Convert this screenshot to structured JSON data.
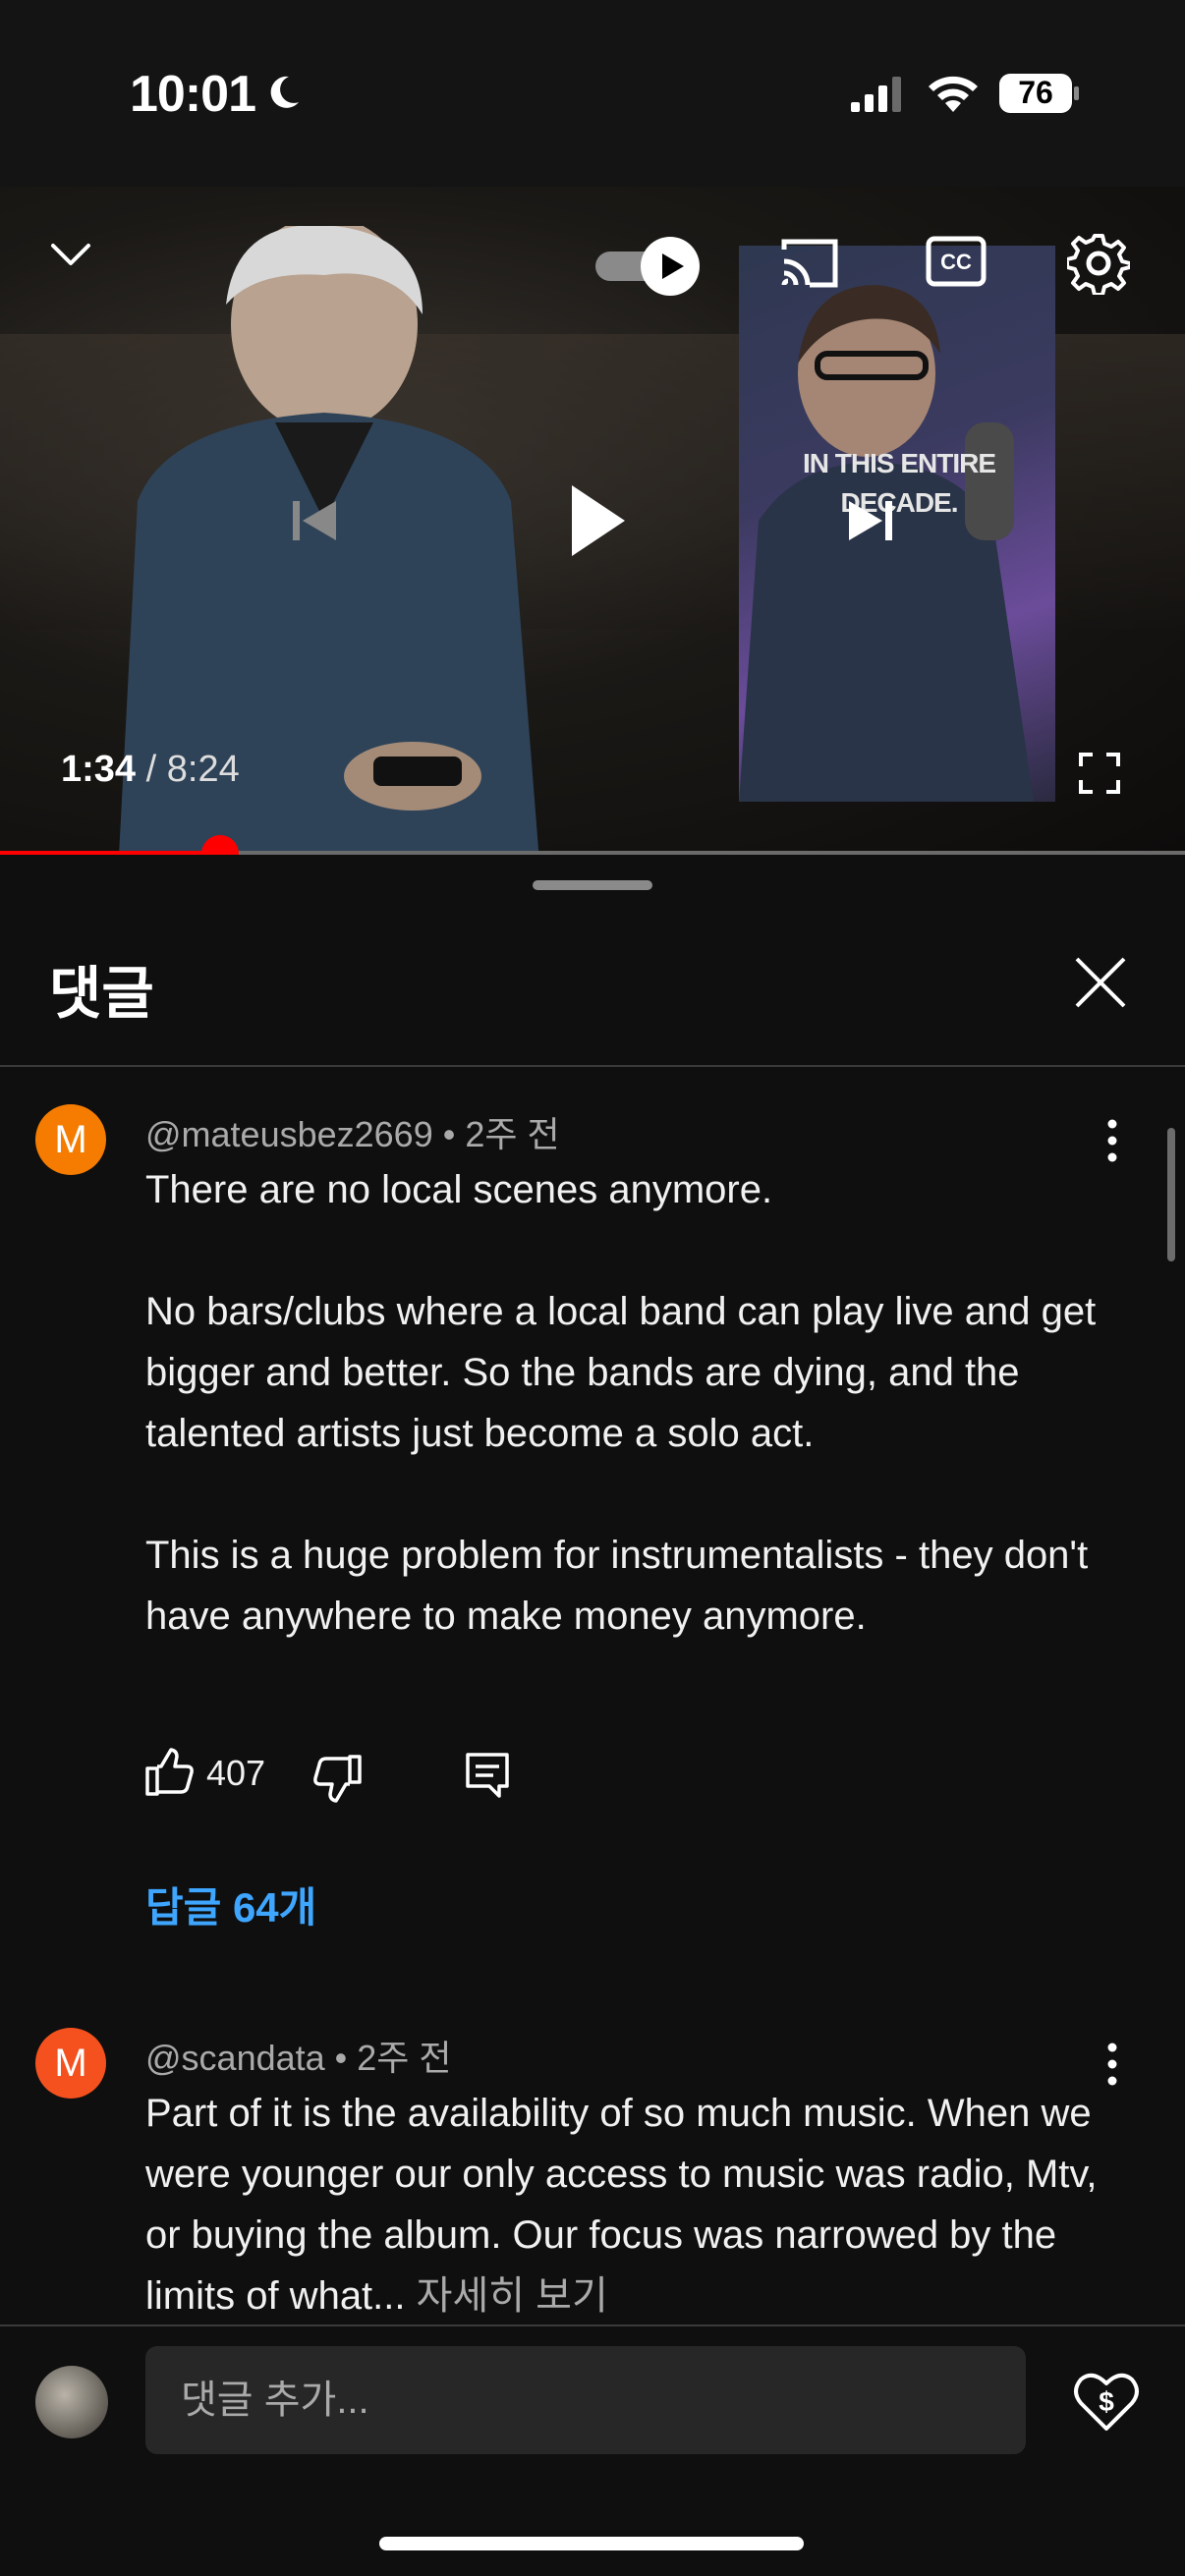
{
  "status_bar": {
    "time": "10:01",
    "battery": "76"
  },
  "video": {
    "current_time": "1:34",
    "separator": " / ",
    "duration": "8:24",
    "progress_fraction": 0.186,
    "side_caption_line1": "IN THIS ENTIRE",
    "side_caption_line2": "DECADE.",
    "autoplay_on": true
  },
  "comments_panel": {
    "title": "댓글",
    "comments": [
      {
        "avatar_letter": "M",
        "avatar_color": "#f57c00",
        "author": "@mateusbez2669",
        "age": "2주 전",
        "text": "There are no local scenes anymore.\n\nNo bars/clubs where a local band can play live and get bigger and better. So the bands are dying, and the talented artists just become a solo act.\n\nThis is a huge problem for instrumentalists - they don't have anywhere to make money anymore.",
        "likes": "407",
        "replies_label": "답글 64개"
      },
      {
        "avatar_letter": "M",
        "avatar_color": "#f4511e",
        "author": "@scandata",
        "age": "2주 전",
        "text": "Part of it is the availability of so much music. When we were younger our only access to music was radio, Mtv, or buying the album. Our focus was narrowed by the limits of what...",
        "read_more": "자세히 보기"
      }
    ]
  },
  "composer": {
    "placeholder": "댓글 추가..."
  },
  "colors": {
    "accent_red": "#ff0000",
    "link_blue": "#3ea6ff",
    "background": "#0f0f0f"
  }
}
